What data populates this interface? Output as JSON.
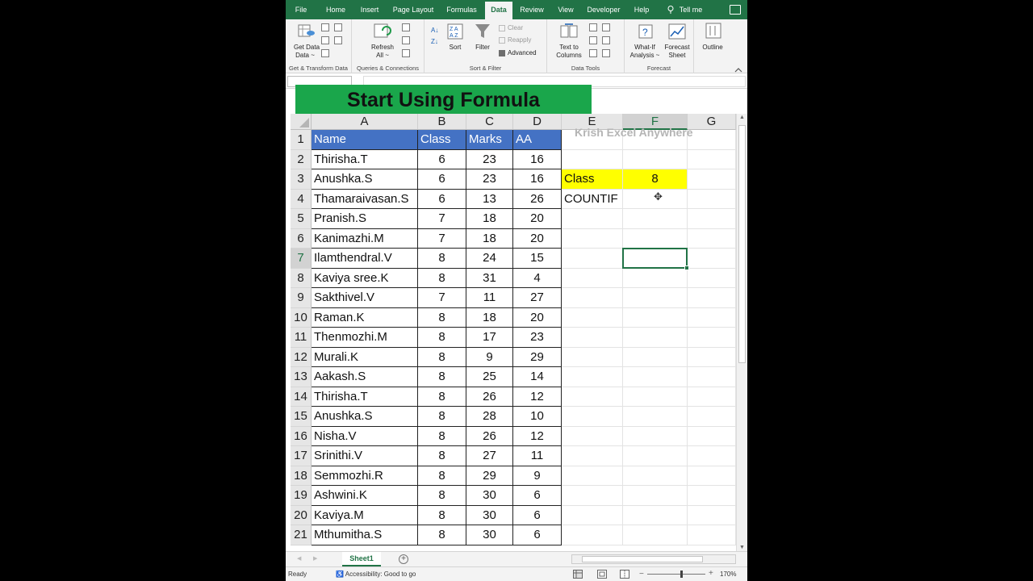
{
  "tabs": [
    "File",
    "Home",
    "Insert",
    "Page Layout",
    "Formulas",
    "Data",
    "Review",
    "View",
    "Developer",
    "Help",
    "Tell me"
  ],
  "active_tab": "Data",
  "ribbon": {
    "get_data": "Get Data",
    "get_data_sub": "Data ~",
    "refresh": "Refresh",
    "refresh_sub": "All ~",
    "sort": "Sort",
    "filter": "Filter",
    "clear": "Clear",
    "reapply": "Reapply",
    "advanced": "Advanced",
    "text_to_columns": "Text to",
    "text_to_columns_2": "Columns",
    "whatif": "What-If",
    "whatif_2": "Analysis ~",
    "forecast_sheet": "Forecast",
    "forecast_sheet_2": "Sheet",
    "outline": "Outline",
    "groups": {
      "get_transform": "Get & Transform Data",
      "queries": "Queries & Connections",
      "sort_filter": "Sort & Filter",
      "data_tools": "Data Tools",
      "forecast": "Forecast"
    }
  },
  "banner": "Start Using Formula",
  "watermark": "Krish Excel Anywhere",
  "columns": [
    "A",
    "B",
    "C",
    "D",
    "E",
    "F",
    "G"
  ],
  "selected_column": "F",
  "selected_row": "7",
  "table": {
    "headers": [
      "Name",
      "Class",
      "Marks",
      "AA"
    ],
    "rows": [
      [
        "Thirisha.T",
        "6",
        "23",
        "16"
      ],
      [
        "Anushka.S",
        "6",
        "23",
        "16"
      ],
      [
        "Thamaraivasan.S",
        "6",
        "13",
        "26"
      ],
      [
        "Pranish.S",
        "7",
        "18",
        "20"
      ],
      [
        "Kanimazhi.M",
        "7",
        "18",
        "20"
      ],
      [
        "Ilamthendral.V",
        "8",
        "24",
        "15"
      ],
      [
        "Kaviya sree.K",
        "8",
        "31",
        "4"
      ],
      [
        "Sakthivel.V",
        "7",
        "11",
        "27"
      ],
      [
        "Raman.K",
        "8",
        "18",
        "20"
      ],
      [
        "Thenmozhi.M",
        "8",
        "17",
        "23"
      ],
      [
        "Murali.K",
        "8",
        "9",
        "29"
      ],
      [
        "Aakash.S",
        "8",
        "25",
        "14"
      ],
      [
        "Thirisha.T",
        "8",
        "26",
        "12"
      ],
      [
        "Anushka.S",
        "8",
        "28",
        "10"
      ],
      [
        "Nisha.V",
        "8",
        "26",
        "12"
      ],
      [
        "Srinithi.V",
        "8",
        "27",
        "11"
      ],
      [
        "Semmozhi.R",
        "8",
        "29",
        "9"
      ],
      [
        "Ashwini.K",
        "8",
        "30",
        "6"
      ],
      [
        "Kaviya.M",
        "8",
        "30",
        "6"
      ],
      [
        "Mthumitha.S",
        "8",
        "30",
        "6"
      ]
    ]
  },
  "side": {
    "class_label": "Class",
    "class_value": "8",
    "countif_label": "COUNTIF"
  },
  "colors": {
    "excel_green": "#217346",
    "header_blue": "#4472c4",
    "highlight_yellow": "#ffff00",
    "banner_green": "#1aa64b"
  },
  "sheet_tab": "Sheet1",
  "status": {
    "ready": "Ready",
    "accessibility": "Accessibility: Good to go",
    "zoom": "170%"
  }
}
